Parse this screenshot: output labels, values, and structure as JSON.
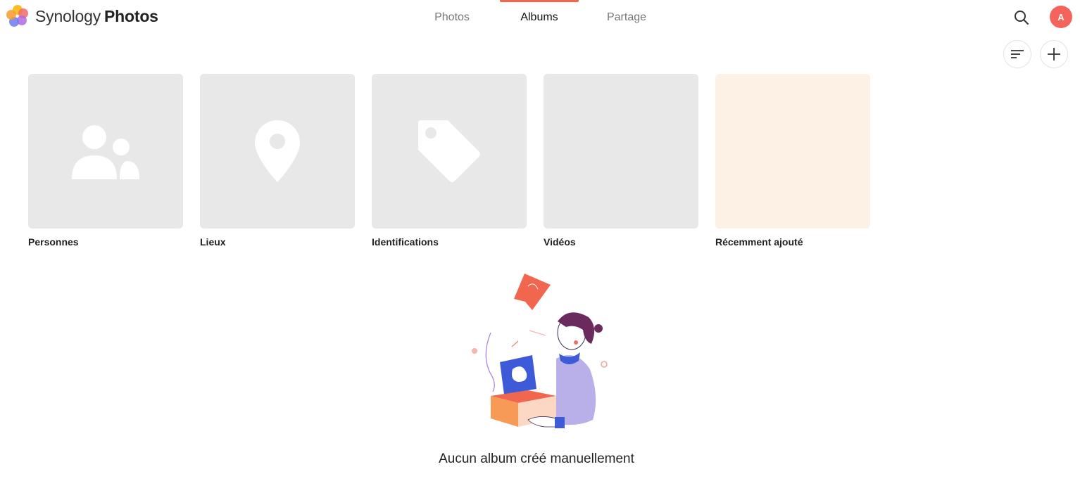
{
  "app": {
    "brand_light": "Synology",
    "brand_bold": "Photos"
  },
  "nav": {
    "tabs": [
      {
        "label": "Photos",
        "active": false
      },
      {
        "label": "Albums",
        "active": true
      },
      {
        "label": "Partage",
        "active": false
      }
    ]
  },
  "header": {
    "search_icon": "search-icon",
    "avatar_initial": "A",
    "avatar_color": "#f5645c",
    "accent_color": "#f0664e"
  },
  "toolbar": {
    "sort_icon": "sort-icon",
    "add_icon": "plus-icon"
  },
  "albums": [
    {
      "label": "Personnes",
      "icon": "people-icon"
    },
    {
      "label": "Lieux",
      "icon": "location-pin-icon"
    },
    {
      "label": "Identifications",
      "icon": "tag-icon"
    },
    {
      "label": "Vidéos",
      "icon": null
    },
    {
      "label": "Récemment ajouté",
      "icon": null
    }
  ],
  "empty_state": {
    "message": "Aucun album créé manuellement"
  }
}
